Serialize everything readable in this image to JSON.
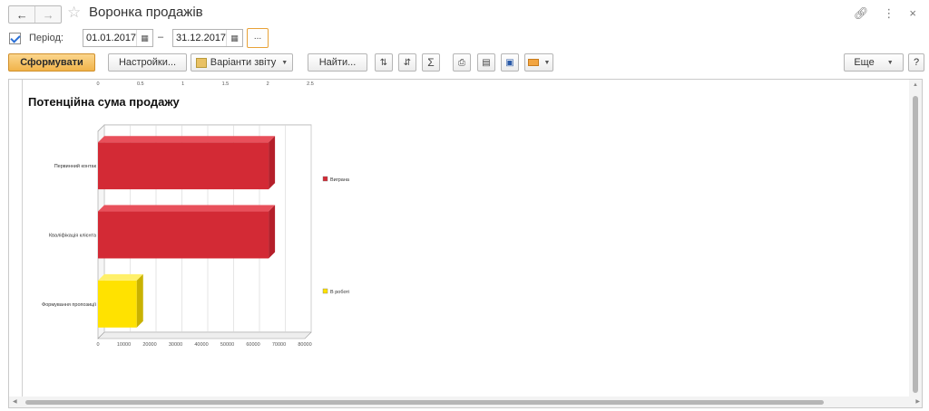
{
  "window": {
    "title": "Воронка продажів"
  },
  "period": {
    "checked": true,
    "label": "Період:",
    "start": "01.01.2017",
    "separator": "–",
    "end": "31.12.2017",
    "more_label": "..."
  },
  "toolbar": {
    "generate_label": "Сформувати",
    "settings_label": "Настройки...",
    "variants_label": "Варіанти звіту",
    "find_label": "Найти...",
    "more_label": "Еще",
    "help_label": "?"
  },
  "icons": {
    "back": "arrow-left-icon",
    "forward": "arrow-right-icon",
    "favorite": "star-icon",
    "link": "link-icon",
    "menu": "more-vertical-icon",
    "close": "close-icon",
    "sort_asc": "sort-ascending-icon",
    "sort_desc": "sort-descending-icon",
    "sum": "sum-icon",
    "print": "print-icon",
    "preview": "print-preview-icon",
    "save": "save-icon",
    "mail": "mail-icon"
  },
  "chart_data": {
    "type": "bar",
    "orientation": "horizontal",
    "title": "Потенційна сума продажу",
    "categories": [
      "Первинний контак",
      "Кваліфікація клієнта",
      "Формування пропозиції"
    ],
    "series": [
      {
        "name": "Виграна",
        "color": "#d32a35",
        "values": [
          66000,
          66000,
          0
        ]
      },
      {
        "name": "В роботі",
        "color": "#ffe200",
        "values": [
          0,
          0,
          15000
        ]
      }
    ],
    "x_ticks": [
      "0",
      "10000",
      "20000",
      "30000",
      "40000",
      "50000",
      "60000",
      "70000",
      "80000"
    ],
    "xlim": [
      0,
      80000
    ],
    "top_axis_ticks": [
      "0",
      "0.5",
      "1",
      "1.5",
      "2",
      "2.5"
    ],
    "grid": true,
    "legend": "right"
  }
}
